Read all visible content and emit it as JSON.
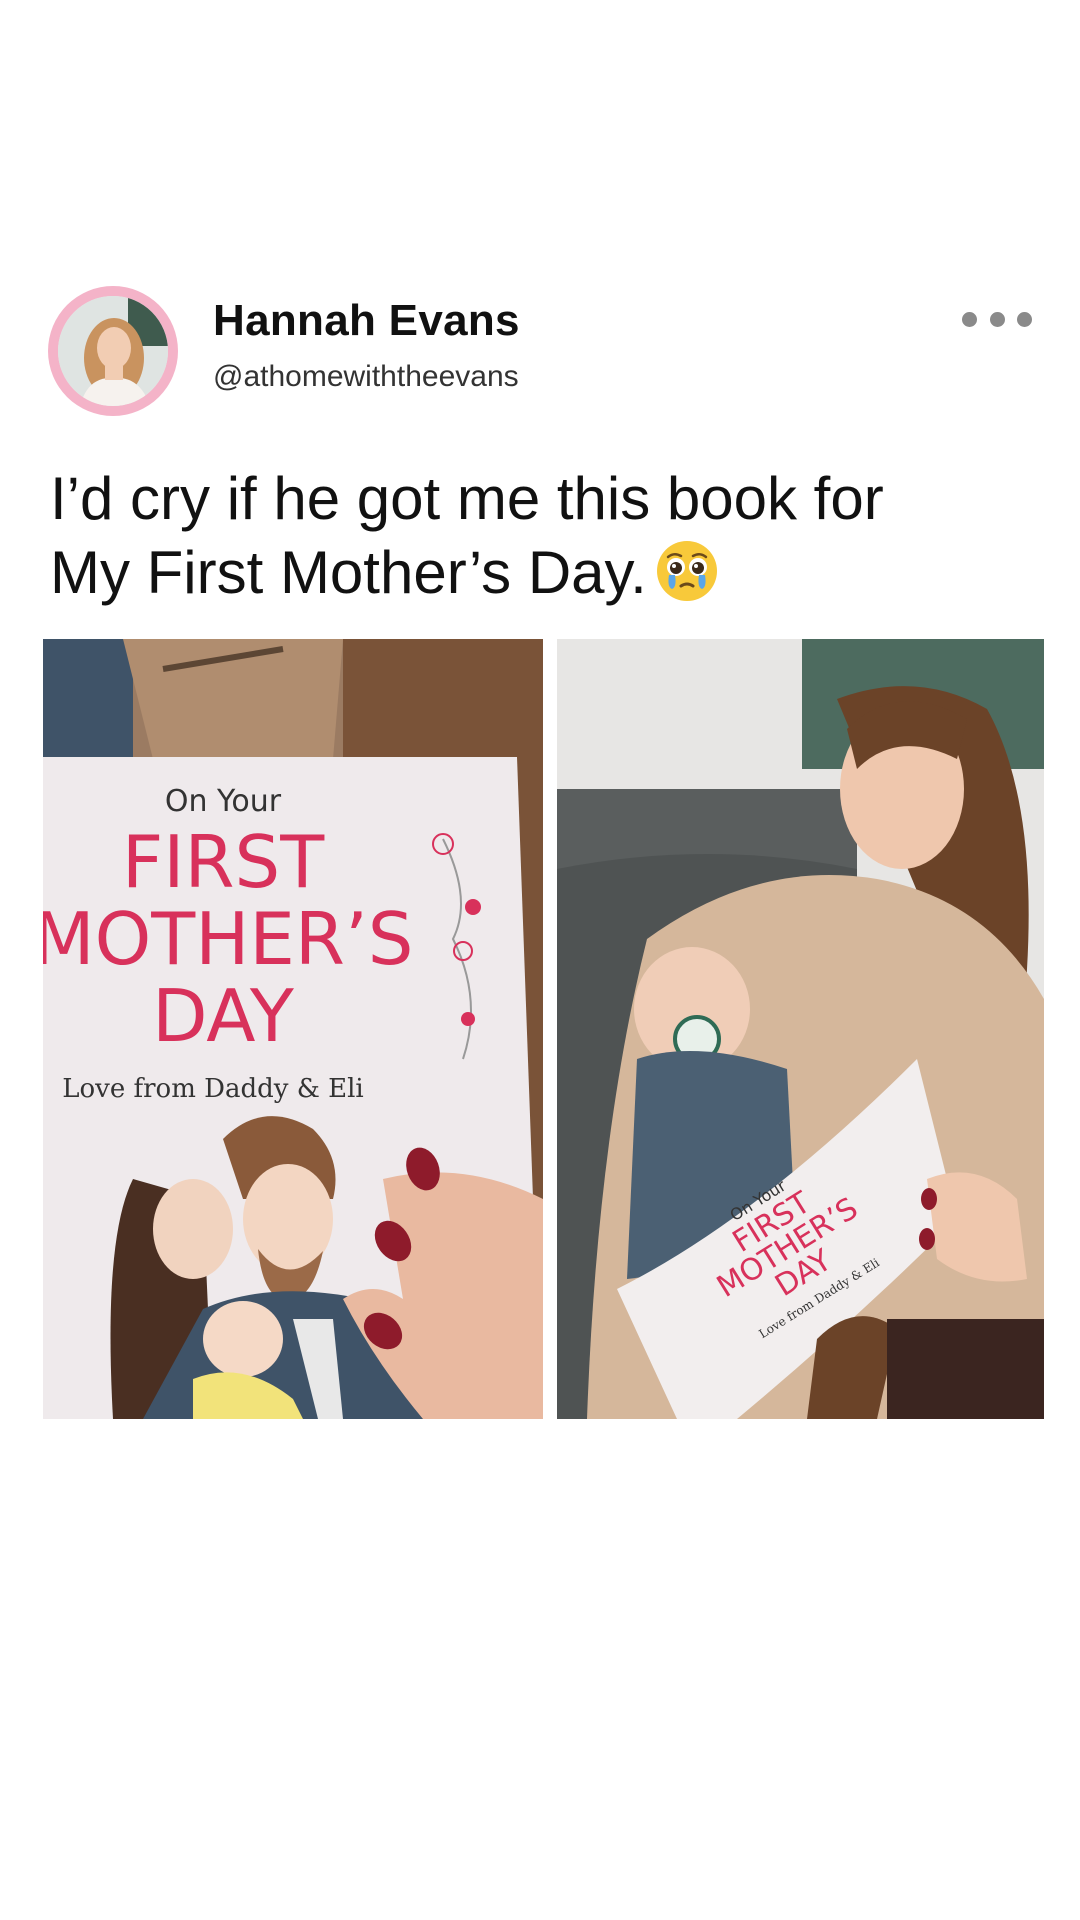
{
  "post": {
    "author": {
      "display_name": "Hannah Evans",
      "handle": "@athomewiththeevans",
      "avatar_icon": "profile-photo"
    },
    "menu_icon": "more-horizontal-icon",
    "text_lines": [
      "I’d cry if he got me this book for",
      "My First Mother’s Day."
    ],
    "emoji": "pleading-face-with-tears-emoji"
  },
  "media": {
    "book_cover": {
      "line1": "On Your",
      "line2": "FIRST",
      "line3": "MOTHER’S",
      "line4": "DAY",
      "dedication": "Love from Daddy & Eli"
    },
    "colors": {
      "title_pink": "#d8315b",
      "avatar_ring": "#f4b3c8",
      "menu_dots": "#8a8a8a"
    }
  }
}
